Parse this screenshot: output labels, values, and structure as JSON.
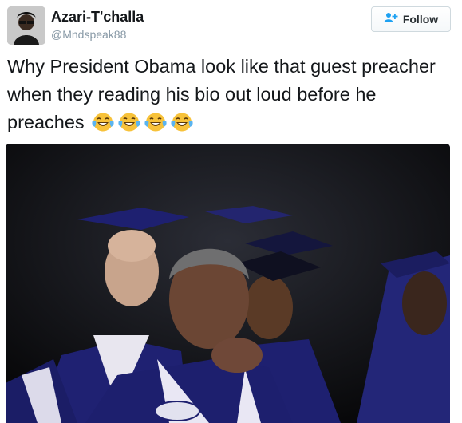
{
  "user": {
    "display_name": "Azari-T'challa",
    "handle": "@Mndspeak88"
  },
  "follow_button": {
    "label": "Follow",
    "icon": "add-user-icon"
  },
  "tweet": {
    "text": "Why President Obama look like that guest preacher when they reading his bio out loud before he preaches",
    "emoji": [
      "face-with-tears-of-joy",
      "face-with-tears-of-joy",
      "face-with-tears-of-joy",
      "face-with-tears-of-joy"
    ]
  },
  "colors": {
    "accent": "#1da1f2",
    "handle": "#8899a6",
    "robe_blue": "#1d1f6e",
    "robe_trim": "#e9e7f4",
    "emoji_yellow": "#f7c23a"
  },
  "media": {
    "icon": "photo-icon"
  }
}
